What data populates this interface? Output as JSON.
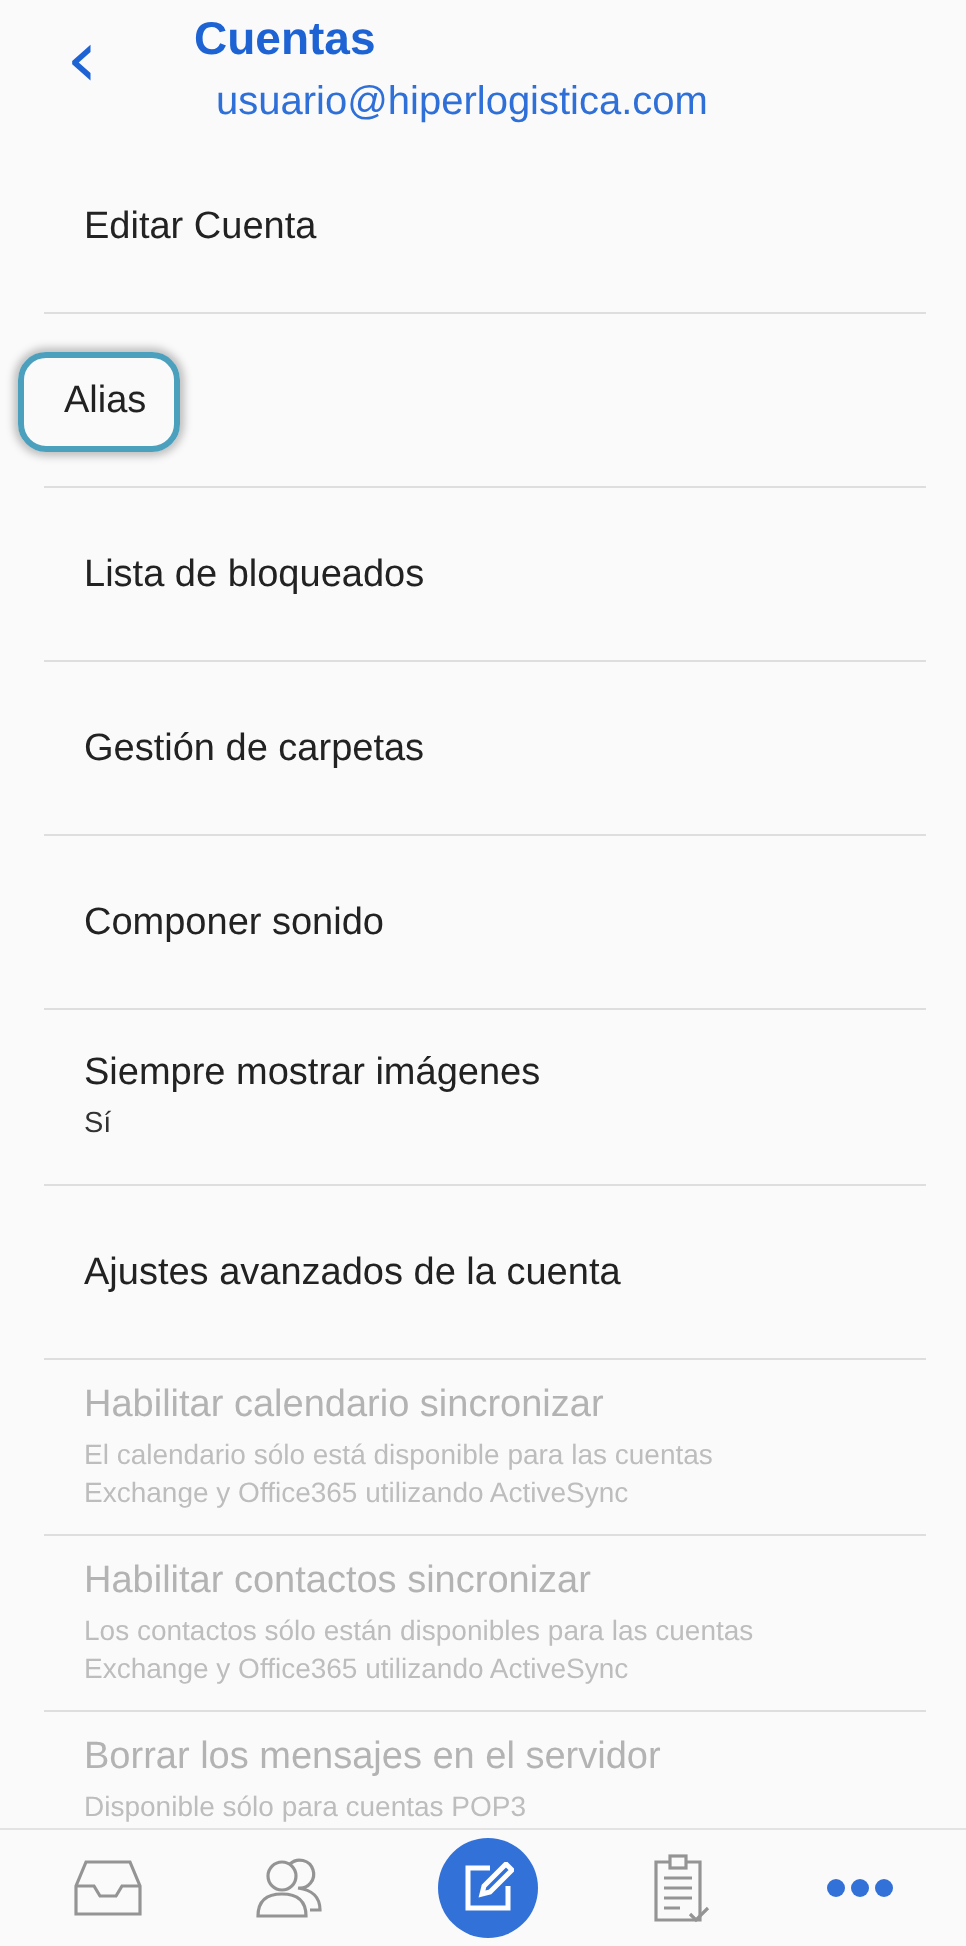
{
  "header": {
    "back": "‹",
    "title": "Cuentas",
    "account": "usuario@hiperlogistica.com"
  },
  "items": [
    {
      "label": "Editar Cuenta",
      "disabled": false,
      "highlighted": false
    },
    {
      "label": "Alias",
      "disabled": false,
      "highlighted": true
    },
    {
      "label": "Lista de bloqueados",
      "disabled": false,
      "highlighted": false
    },
    {
      "label": "Gestión de carpetas",
      "disabled": false,
      "highlighted": false
    },
    {
      "label": "Componer sonido",
      "disabled": false,
      "highlighted": false
    },
    {
      "label": "Siempre mostrar imágenes",
      "value": "Sí",
      "disabled": false,
      "highlighted": false
    },
    {
      "label": "Ajustes avanzados de la cuenta",
      "disabled": false,
      "highlighted": false
    },
    {
      "label": "Habilitar calendario sincronizar",
      "value": "El calendario sólo está disponible para las cuentas Exchange y Office365 utilizando ActiveSync",
      "disabled": true,
      "highlighted": false
    },
    {
      "label": "Habilitar contactos sincronizar",
      "value": "Los contactos sólo están disponibles para las cuentas Exchange y Office365 utilizando ActiveSync",
      "disabled": true,
      "highlighted": false
    },
    {
      "label": "Borrar los mensajes en el servidor",
      "value": "Disponible sólo para cuentas POP3",
      "disabled": true,
      "highlighted": false
    }
  ],
  "nav": [
    {
      "kind": "inbox"
    },
    {
      "kind": "contacts"
    },
    {
      "kind": "compose"
    },
    {
      "kind": "tasks"
    },
    {
      "kind": "more"
    }
  ]
}
